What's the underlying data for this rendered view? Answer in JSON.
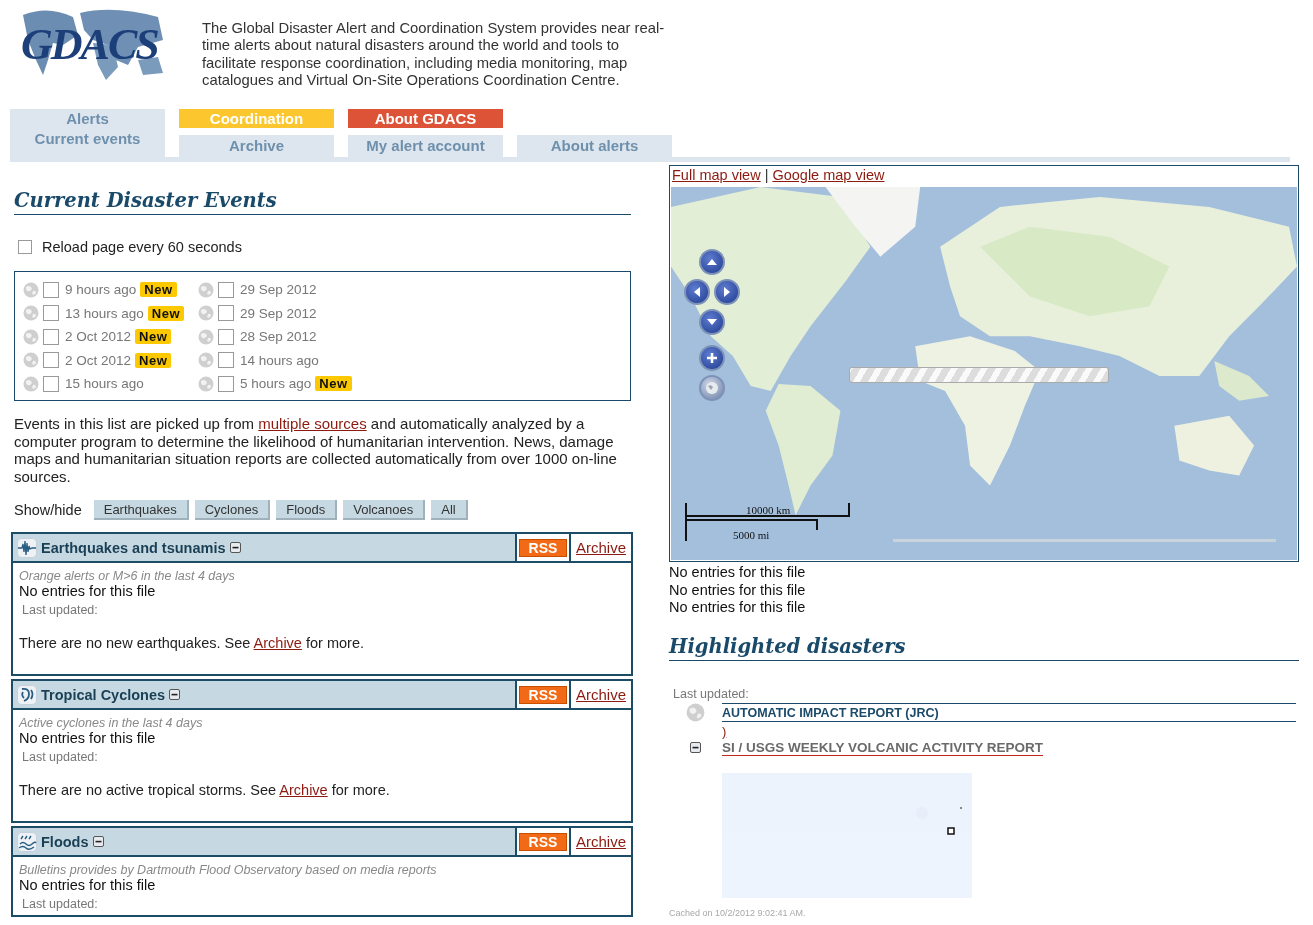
{
  "header": {
    "logo": "GDACS",
    "description": "The Global Disaster Alert and Coordination System provides near real-time alerts about natural disasters around the world and tools to facilitate response coordination, including media monitoring, map catalogues and Virtual On-Site Operations Coordination Centre."
  },
  "nav": [
    {
      "top": "Alerts",
      "bottom": "Current events",
      "color": "#dde6ee",
      "selected": true
    },
    {
      "top": "Coordination",
      "bottom": "Archive",
      "color": "#fcc72e",
      "selected": false
    },
    {
      "top": "About GDACS",
      "bottom": "My alert account",
      "color": "#dc5337",
      "selected": false
    },
    {
      "bottom": "About alerts",
      "selected": false
    }
  ],
  "events": {
    "title": "Current Disaster Events",
    "reload": {
      "label": "Reload page every 60 seconds",
      "checked": false
    },
    "columns": [
      {
        "items": [
          {
            "time": "9 hours ago",
            "badge": "New",
            "checked": false
          },
          {
            "time": "13 hours ago",
            "badge": "New",
            "checked": false
          },
          {
            "time": "2 Oct 2012",
            "badge": "New",
            "checked": false
          },
          {
            "time": "2 Oct 2012",
            "badge": "New",
            "checked": false
          },
          {
            "time": "15 hours ago",
            "checked": false
          }
        ]
      },
      {
        "items": [
          {
            "time": "29 Sep 2012",
            "checked": false
          },
          {
            "time": "29 Sep 2012",
            "checked": false
          },
          {
            "time": "28 Sep 2012",
            "checked": false
          },
          {
            "time": "14 hours ago",
            "checked": false
          },
          {
            "time": "5 hours ago",
            "badge": "New",
            "checked": false
          }
        ]
      }
    ],
    "intro": {
      "before": "Events in this list are picked up from ",
      "link": "multiple sources",
      "after": " and automatically analyzed by a computer program to determine the likelihood of humanitarian intervention. News, damage maps and humanitarian situation reports are collected automatically from over 1000 on-line sources."
    },
    "filter": {
      "label": "Show/hide",
      "buttons": [
        "Earthquakes",
        "Cyclones",
        "Floods",
        "Volcanoes",
        "All"
      ]
    }
  },
  "sections": [
    {
      "kind": "earthquake",
      "title": "Earthquakes and tsunamis",
      "expanded": true,
      "rss": "RSS",
      "archive": "Archive",
      "note": "Orange alerts or M>6 in the last 4 days",
      "empty": "No entries for this file",
      "updated": "Last updated:",
      "message": {
        "before": "There are no new earthquakes. See ",
        "link": "Archive",
        "after": " for more."
      }
    },
    {
      "kind": "cyclone",
      "title": "Tropical Cyclones",
      "expanded": true,
      "rss": "RSS",
      "archive": "Archive",
      "note": "Active cyclones in the last 4 days",
      "empty": "No entries for this file",
      "updated": "Last updated:",
      "message": {
        "before": "There are no active tropical storms. See ",
        "link": "Archive",
        "after": " for more."
      }
    },
    {
      "kind": "flood",
      "title": "Floods",
      "expanded": true,
      "rss": "RSS",
      "archive": "Archive",
      "note": "Bulletins provides by Dartmouth Flood Observatory based on media reports",
      "empty": "No entries for this file",
      "updated": "Last updated:"
    }
  ],
  "map": {
    "links": [
      "Full map view",
      "Google map view"
    ],
    "separator": "|",
    "scale": [
      "10000 km",
      "5000 mi"
    ]
  },
  "feeds": [
    "No entries for this file",
    "No entries for this file",
    "No entries for this file"
  ],
  "highlighted": {
    "title": "Highlighted disasters",
    "updated": "Last updated:",
    "impact_report": "AUTOMATIC IMPACT REPORT (JRC)",
    "stray_link": ")",
    "volcano_report": {
      "title": "SI / USGS WEEKLY VOLCANIC ACTIVITY REPORT",
      "expanded": true
    },
    "cached": "Cached on 10/2/2012 9:02:41 AM."
  }
}
